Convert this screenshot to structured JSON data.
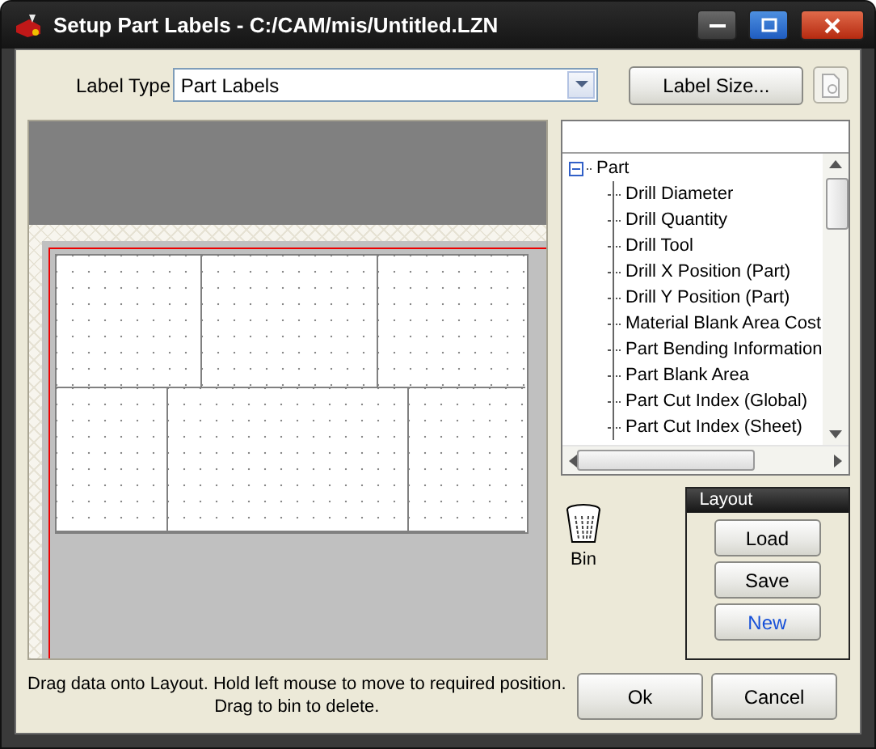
{
  "window": {
    "title": "Setup Part Labels - C:/CAM/mis/Untitled.LZN"
  },
  "label_type": {
    "label": "Label Type",
    "value": "Part Labels"
  },
  "label_size_button": "Label Size...",
  "tree": [
    {
      "label": "Part",
      "expanded": true,
      "children": [
        {
          "label": "Drill Diameter"
        },
        {
          "label": "Drill Quantity"
        },
        {
          "label": "Drill Tool"
        },
        {
          "label": "Drill X Position (Part)"
        },
        {
          "label": "Drill Y Position (Part)"
        },
        {
          "label": "Material Blank Area Cost"
        },
        {
          "label": "Part Bending Information"
        },
        {
          "label": "Part Blank Area"
        },
        {
          "label": "Part Cut Index (Global)"
        },
        {
          "label": "Part Cut Index (Sheet)"
        }
      ]
    }
  ],
  "bin": {
    "label": "Bin"
  },
  "layout_group": {
    "title": "Layout",
    "buttons": [
      {
        "label": "Load",
        "highlighted": false
      },
      {
        "label": "Save",
        "highlighted": false
      },
      {
        "label": "New",
        "highlighted": true
      }
    ]
  },
  "hint_lines": [
    "Drag data onto Layout. Hold left mouse to move to required position.",
    "Drag to bin to delete."
  ],
  "buttons": [
    {
      "label": "Ok"
    },
    {
      "label": "Cancel"
    }
  ]
}
